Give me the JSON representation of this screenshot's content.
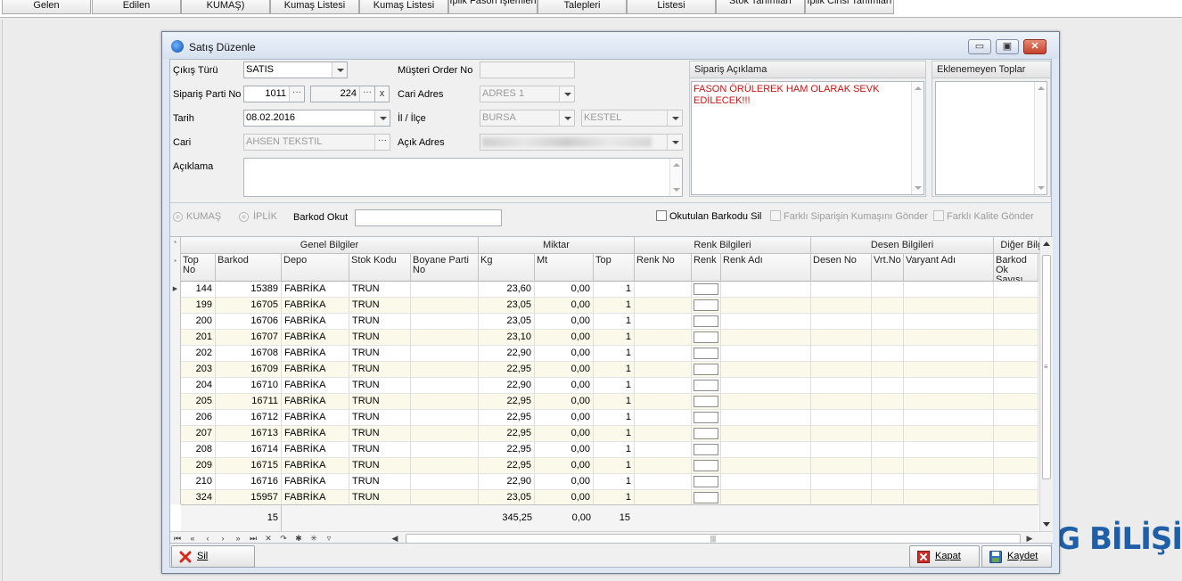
{
  "top_tabs": [
    {
      "label": "Gelen",
      "two_line": false
    },
    {
      "label": "Edilen",
      "two_line": false
    },
    {
      "label": "KUMAŞ)",
      "two_line": false
    },
    {
      "label": "Kumaş Listesi",
      "two_line": false
    },
    {
      "label": "Kumaş Listesi",
      "two_line": false
    },
    {
      "label": "İplik Fason İşlemleri",
      "two_line": true
    },
    {
      "label": "Talepleri",
      "two_line": false
    },
    {
      "label": "Listesi",
      "two_line": false
    },
    {
      "label": "Stok Tanımları",
      "two_line": true
    },
    {
      "label": "İplik Cinsi Tanımları",
      "two_line": true
    }
  ],
  "watermark": "BG BİLİŞİ",
  "dialog": {
    "title": "Satış Düzenle",
    "form": {
      "cikis_turu_label": "Çıkış Türü",
      "cikis_turu_value": "SATIS",
      "siparis_parti_label": "Sipariş Parti No",
      "siparis_parti_value": "1011",
      "siparis_parti_value2": "224",
      "clear_label": "x",
      "tarih_label": "Tarih",
      "tarih_value": "08.02.2016",
      "cari_label": "Cari",
      "cari_value": "AHSEN TEKSTIL",
      "aciklama_label": "Açıklama",
      "aciklama_value": "",
      "musteri_order_label": "Müşteri Order No",
      "musteri_order_value": "",
      "cari_adres_label": "Cari Adres",
      "cari_adres_value": "ADRES 1",
      "il_ilce_label": "İl / İlçe",
      "il_value": "BURSA",
      "ilce_value": "KESTEL",
      "acik_adres_label": "Açık Adres",
      "acik_adres_value": ""
    },
    "siparis_aciklama": {
      "title": "Sipariş Açıklama",
      "text": "FASON ÖRÜLEREK HAM OLARAK SEVK EDİLECEK!!!"
    },
    "eklenemeyen_toplar": {
      "title": "Eklenemeyen Toplar"
    },
    "options": {
      "kumas_label": "KUMAŞ",
      "iplik_label": "İPLİK",
      "barkod_okut_label": "Barkod Okut",
      "barkod_okut_value": "",
      "okutulan_barkodu_sil_label": "Okutulan Barkodu Sil",
      "farkli_siparis_label": "Farklı Siparişin Kumaşını Gönder",
      "farkli_kalite_label": "Farklı Kalite Gönder"
    },
    "grid": {
      "bands": [
        "Genel Bilgiler",
        "Miktar",
        "Renk Bilgileri",
        "Desen Bilgileri",
        "Diğer Bilgi"
      ],
      "columns": [
        "Top No",
        "Barkod",
        "Depo",
        "Stok Kodu",
        "Boyane Parti No",
        "Kg",
        "Mt",
        "Top",
        "Renk No",
        "Renk",
        "Renk Adı",
        "Desen No",
        "Vrt.No",
        "Varyant Adı",
        "Barkod Ok Sayısı"
      ],
      "rows": [
        {
          "top_no": "144",
          "barkod": "15389",
          "depo": "FABRİKA",
          "stok": "TRUN",
          "kg": "23,60",
          "mt": "0,00",
          "top": "1"
        },
        {
          "top_no": "199",
          "barkod": "16705",
          "depo": "FABRİKA",
          "stok": "TRUN",
          "kg": "23,05",
          "mt": "0,00",
          "top": "1"
        },
        {
          "top_no": "200",
          "barkod": "16706",
          "depo": "FABRİKA",
          "stok": "TRUN",
          "kg": "23,05",
          "mt": "0,00",
          "top": "1"
        },
        {
          "top_no": "201",
          "barkod": "16707",
          "depo": "FABRİKA",
          "stok": "TRUN",
          "kg": "23,10",
          "mt": "0,00",
          "top": "1"
        },
        {
          "top_no": "202",
          "barkod": "16708",
          "depo": "FABRİKA",
          "stok": "TRUN",
          "kg": "22,90",
          "mt": "0,00",
          "top": "1"
        },
        {
          "top_no": "203",
          "barkod": "16709",
          "depo": "FABRİKA",
          "stok": "TRUN",
          "kg": "22,95",
          "mt": "0,00",
          "top": "1"
        },
        {
          "top_no": "204",
          "barkod": "16710",
          "depo": "FABRİKA",
          "stok": "TRUN",
          "kg": "22,90",
          "mt": "0,00",
          "top": "1"
        },
        {
          "top_no": "205",
          "barkod": "16711",
          "depo": "FABRİKA",
          "stok": "TRUN",
          "kg": "22,95",
          "mt": "0,00",
          "top": "1"
        },
        {
          "top_no": "206",
          "barkod": "16712",
          "depo": "FABRİKA",
          "stok": "TRUN",
          "kg": "22,95",
          "mt": "0,00",
          "top": "1"
        },
        {
          "top_no": "207",
          "barkod": "16713",
          "depo": "FABRİKA",
          "stok": "TRUN",
          "kg": "22,95",
          "mt": "0,00",
          "top": "1"
        },
        {
          "top_no": "208",
          "barkod": "16714",
          "depo": "FABRİKA",
          "stok": "TRUN",
          "kg": "22,95",
          "mt": "0,00",
          "top": "1"
        },
        {
          "top_no": "209",
          "barkod": "16715",
          "depo": "FABRİKA",
          "stok": "TRUN",
          "kg": "22,95",
          "mt": "0,00",
          "top": "1"
        },
        {
          "top_no": "210",
          "barkod": "16716",
          "depo": "FABRİKA",
          "stok": "TRUN",
          "kg": "22,90",
          "mt": "0,00",
          "top": "1"
        },
        {
          "top_no": "324",
          "barkod": "15957",
          "depo": "FABRİKA",
          "stok": "TRUN",
          "kg": "23,05",
          "mt": "0,00",
          "top": "1"
        }
      ],
      "footer": {
        "count": "15",
        "kg_total": "345,25",
        "mt_total": "0,00",
        "top_total": "15"
      }
    },
    "buttons": {
      "sil": "Sil",
      "kapat": "Kapat",
      "kaydet": "Kaydet"
    }
  },
  "colors": {
    "accent_blue": "#1f5fa8",
    "note_red": "#d01010",
    "row_alt": "#fbfaea"
  }
}
